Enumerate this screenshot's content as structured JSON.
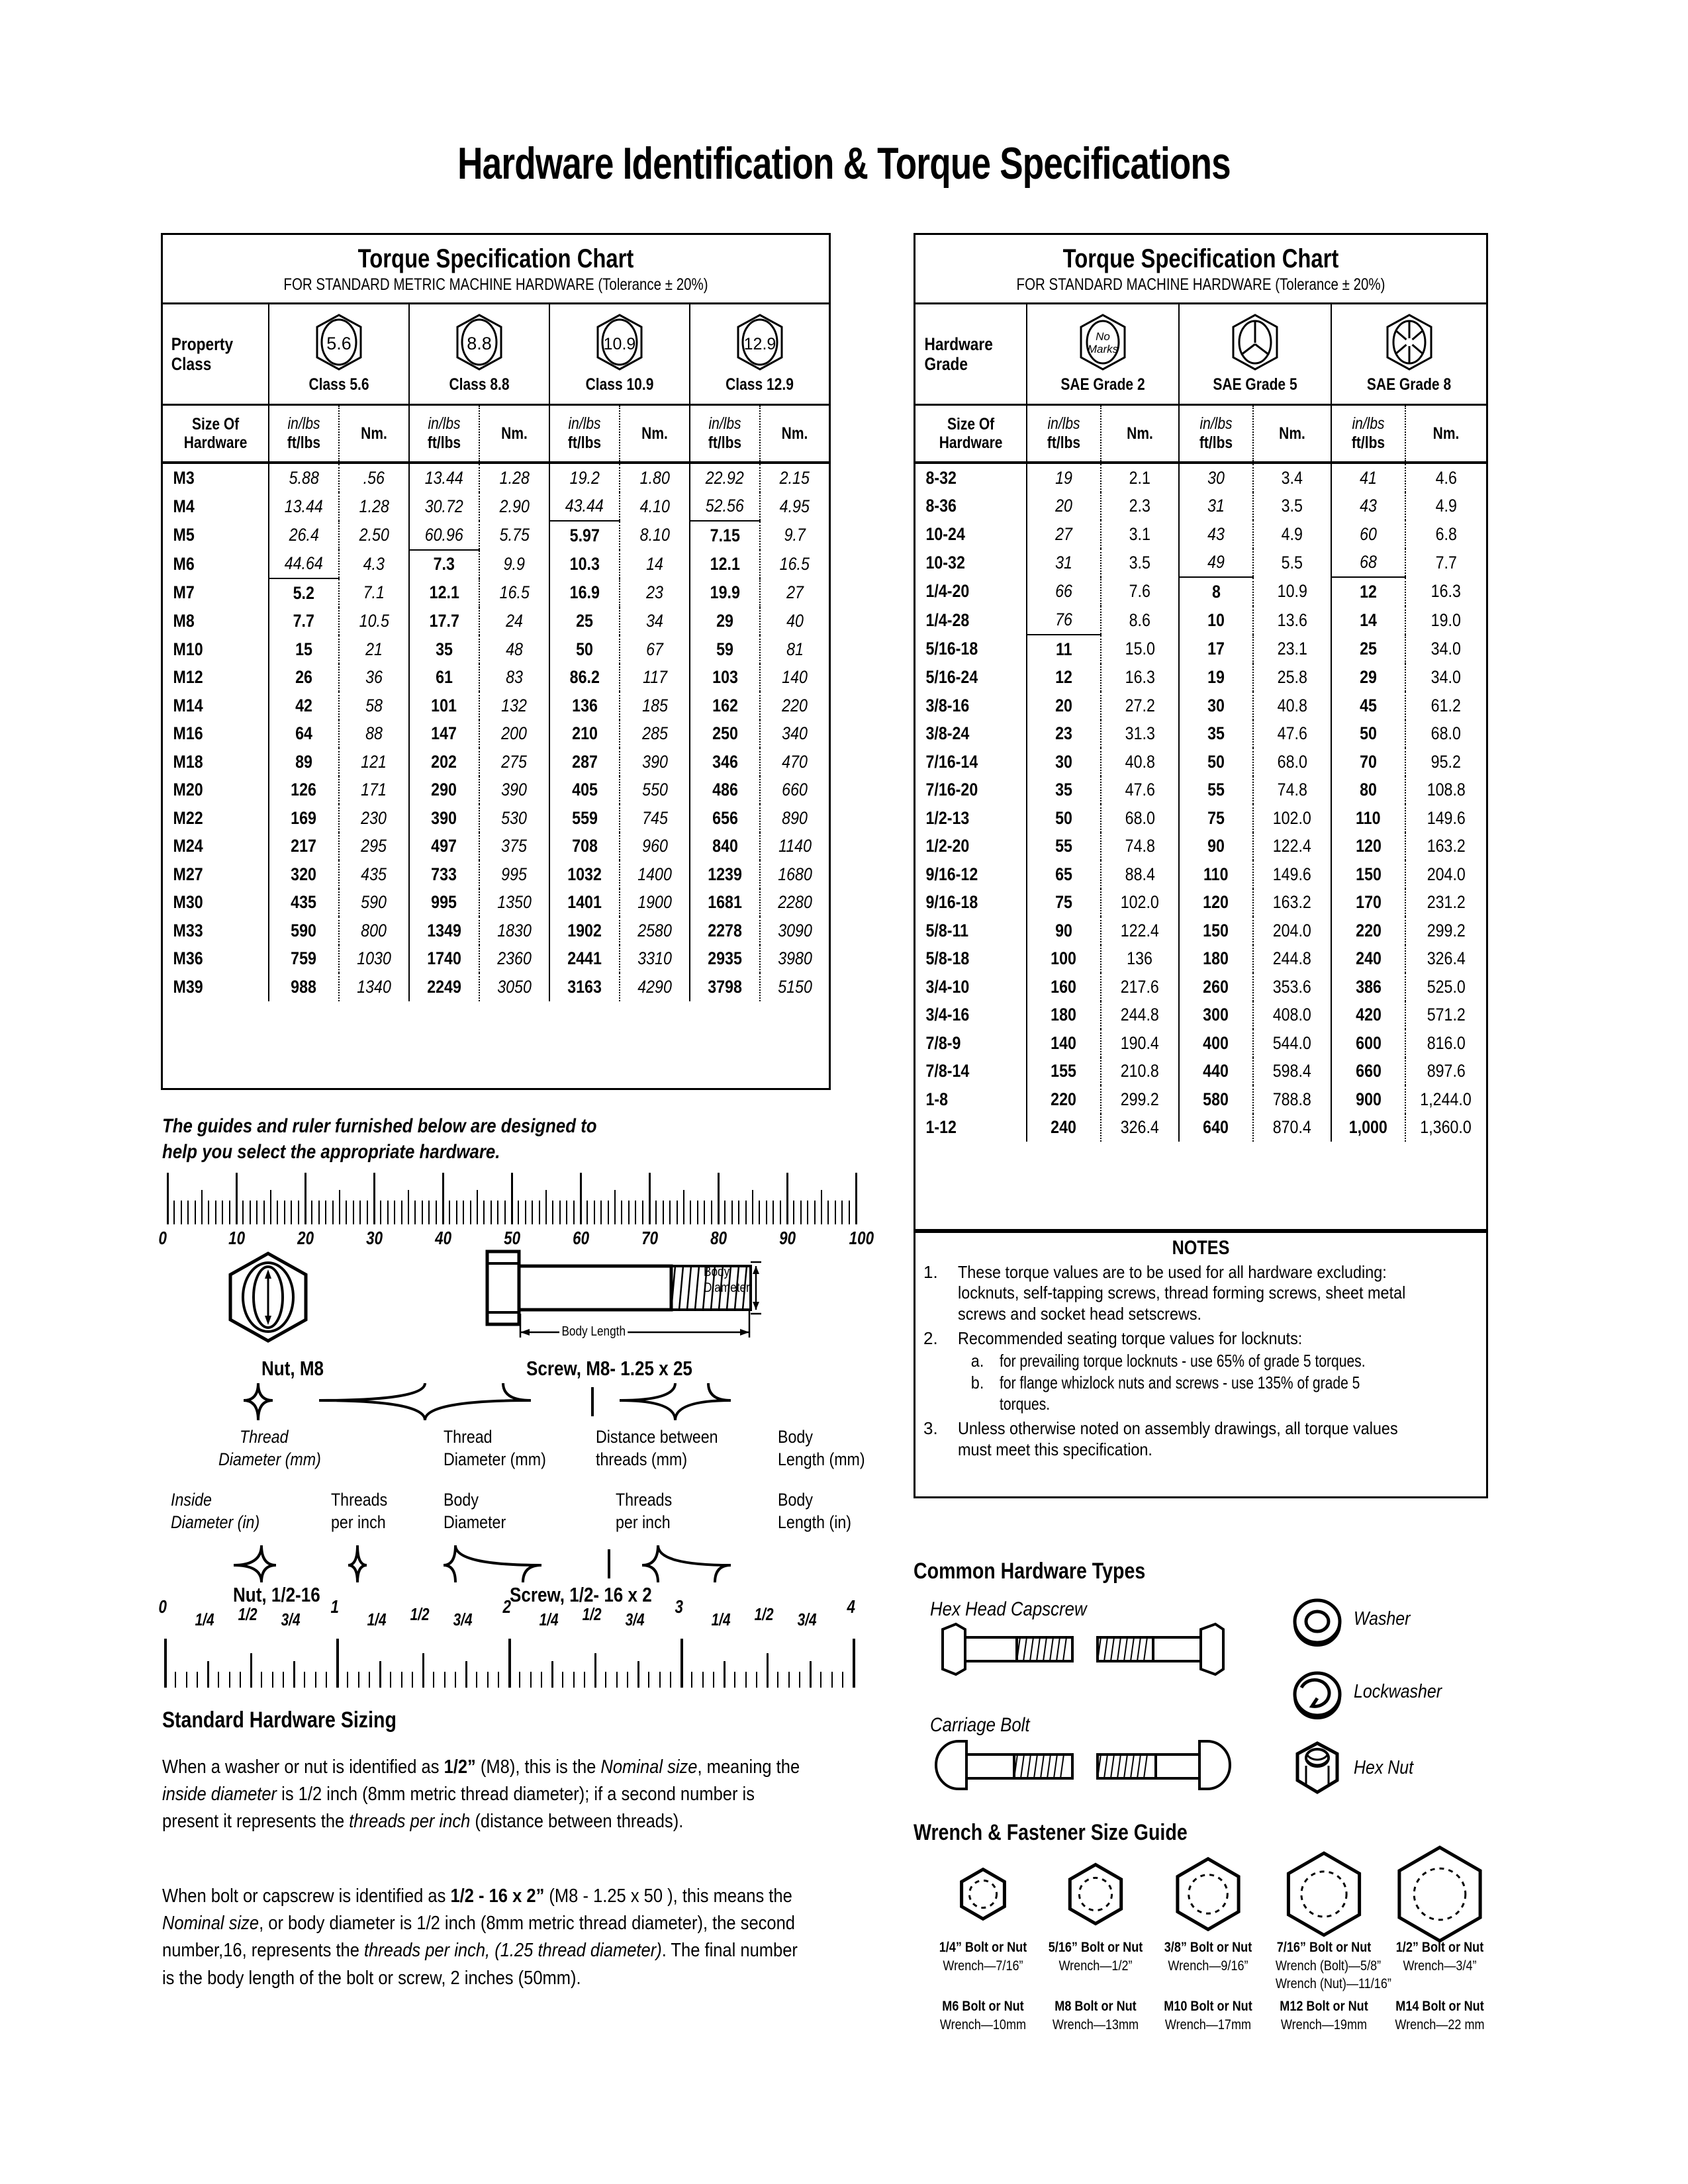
{
  "title": "Hardware Identification  &  Torque Specifications",
  "metric_chart": {
    "title": "Torque Specification Chart",
    "subtitle": "FOR STANDARD METRIC MACHINE HARDWARE (Tolerance ± 20%)",
    "grade_header": "Property Class",
    "size_header": "Size Of Hardware",
    "unit_inlbs": "in/lbs",
    "unit_ftlbs": "ft/lbs",
    "unit_nm": "Nm.",
    "grades": [
      {
        "mark": "5.6",
        "name": "Class 5.6"
      },
      {
        "mark": "8.8",
        "name": "Class 8.8"
      },
      {
        "mark": "10.9",
        "name": "Class 10.9"
      },
      {
        "mark": "12.9",
        "name": "Class 12.9"
      }
    ],
    "rows": [
      {
        "size": "M3",
        "c": [
          "5.88",
          ".56",
          "13.44",
          "1.28",
          "19.2",
          "1.80",
          "22.92",
          "2.15"
        ]
      },
      {
        "size": "M4",
        "c": [
          "13.44",
          "1.28",
          "30.72",
          "2.90",
          "43.44",
          "4.10",
          "52.56",
          "4.95"
        ]
      },
      {
        "size": "M5",
        "c": [
          "26.4",
          "2.50",
          "60.96",
          "5.75",
          "5.97",
          "8.10",
          "7.15",
          "9.7"
        ]
      },
      {
        "size": "M6",
        "c": [
          "44.64",
          "4.3",
          "7.3",
          "9.9",
          "10.3",
          "14",
          "12.1",
          "16.5"
        ]
      },
      {
        "size": "M7",
        "c": [
          "5.2",
          "7.1",
          "12.1",
          "16.5",
          "16.9",
          "23",
          "19.9",
          "27"
        ]
      },
      {
        "size": "M8",
        "c": [
          "7.7",
          "10.5",
          "17.7",
          "24",
          "25",
          "34",
          "29",
          "40"
        ]
      },
      {
        "size": "M10",
        "c": [
          "15",
          "21",
          "35",
          "48",
          "50",
          "67",
          "59",
          "81"
        ]
      },
      {
        "size": "M12",
        "c": [
          "26",
          "36",
          "61",
          "83",
          "86.2",
          "117",
          "103",
          "140"
        ]
      },
      {
        "size": "M14",
        "c": [
          "42",
          "58",
          "101",
          "132",
          "136",
          "185",
          "162",
          "220"
        ]
      },
      {
        "size": "M16",
        "c": [
          "64",
          "88",
          "147",
          "200",
          "210",
          "285",
          "250",
          "340"
        ]
      },
      {
        "size": "M18",
        "c": [
          "89",
          "121",
          "202",
          "275",
          "287",
          "390",
          "346",
          "470"
        ]
      },
      {
        "size": "M20",
        "c": [
          "126",
          "171",
          "290",
          "390",
          "405",
          "550",
          "486",
          "660"
        ]
      },
      {
        "size": "M22",
        "c": [
          "169",
          "230",
          "390",
          "530",
          "559",
          "745",
          "656",
          "890"
        ]
      },
      {
        "size": "M24",
        "c": [
          "217",
          "295",
          "497",
          "375",
          "708",
          "960",
          "840",
          "1140"
        ]
      },
      {
        "size": "M27",
        "c": [
          "320",
          "435",
          "733",
          "995",
          "1032",
          "1400",
          "1239",
          "1680"
        ]
      },
      {
        "size": "M30",
        "c": [
          "435",
          "590",
          "995",
          "1350",
          "1401",
          "1900",
          "1681",
          "2280"
        ]
      },
      {
        "size": "M33",
        "c": [
          "590",
          "800",
          "1349",
          "1830",
          "1902",
          "2580",
          "2278",
          "3090"
        ]
      },
      {
        "size": "M36",
        "c": [
          "759",
          "1030",
          "1740",
          "2360",
          "2441",
          "3310",
          "2935",
          "3980"
        ]
      },
      {
        "size": "M39",
        "c": [
          "988",
          "1340",
          "2249",
          "3050",
          "3163",
          "4290",
          "3798",
          "5150"
        ]
      }
    ]
  },
  "sae_chart": {
    "title": "Torque Specification Chart",
    "subtitle": "FOR STANDARD MACHINE HARDWARE (Tolerance ± 20%)",
    "grade_header": "Hardware Grade",
    "size_header": "Size Of Hardware",
    "unit_inlbs": "in/lbs",
    "unit_ftlbs": "ft/lbs",
    "unit_nm": "Nm.",
    "grades": [
      {
        "mark": "No Marks",
        "name": "SAE Grade 2"
      },
      {
        "mark": "",
        "name": "SAE Grade 5"
      },
      {
        "mark": "",
        "name": "SAE Grade 8"
      }
    ],
    "rows": [
      {
        "size": "8-32",
        "c": [
          "19",
          "2.1",
          "30",
          "3.4",
          "41",
          "4.6"
        ]
      },
      {
        "size": "8-36",
        "c": [
          "20",
          "2.3",
          "31",
          "3.5",
          "43",
          "4.9"
        ]
      },
      {
        "size": "10-24",
        "c": [
          "27",
          "3.1",
          "43",
          "4.9",
          "60",
          "6.8"
        ]
      },
      {
        "size": "10-32",
        "c": [
          "31",
          "3.5",
          "49",
          "5.5",
          "68",
          "7.7"
        ]
      },
      {
        "size": "1/4-20",
        "c": [
          "66",
          "7.6",
          "8",
          "10.9",
          "12",
          "16.3"
        ]
      },
      {
        "size": "1/4-28",
        "c": [
          "76",
          "8.6",
          "10",
          "13.6",
          "14",
          "19.0"
        ]
      },
      {
        "size": "5/16-18",
        "c": [
          "11",
          "15.0",
          "17",
          "23.1",
          "25",
          "34.0"
        ]
      },
      {
        "size": "5/16-24",
        "c": [
          "12",
          "16.3",
          "19",
          "25.8",
          "29",
          "34.0"
        ]
      },
      {
        "size": "3/8-16",
        "c": [
          "20",
          "27.2",
          "30",
          "40.8",
          "45",
          "61.2"
        ]
      },
      {
        "size": "3/8-24",
        "c": [
          "23",
          "31.3",
          "35",
          "47.6",
          "50",
          "68.0"
        ]
      },
      {
        "size": "7/16-14",
        "c": [
          "30",
          "40.8",
          "50",
          "68.0",
          "70",
          "95.2"
        ]
      },
      {
        "size": "7/16-20",
        "c": [
          "35",
          "47.6",
          "55",
          "74.8",
          "80",
          "108.8"
        ]
      },
      {
        "size": "1/2-13",
        "c": [
          "50",
          "68.0",
          "75",
          "102.0",
          "110",
          "149.6"
        ]
      },
      {
        "size": "1/2-20",
        "c": [
          "55",
          "74.8",
          "90",
          "122.4",
          "120",
          "163.2"
        ]
      },
      {
        "size": "9/16-12",
        "c": [
          "65",
          "88.4",
          "110",
          "149.6",
          "150",
          "204.0"
        ]
      },
      {
        "size": "9/16-18",
        "c": [
          "75",
          "102.0",
          "120",
          "163.2",
          "170",
          "231.2"
        ]
      },
      {
        "size": "5/8-11",
        "c": [
          "90",
          "122.4",
          "150",
          "204.0",
          "220",
          "299.2"
        ]
      },
      {
        "size": "5/8-18",
        "c": [
          "100",
          "136",
          "180",
          "244.8",
          "240",
          "326.4"
        ]
      },
      {
        "size": "3/4-10",
        "c": [
          "160",
          "217.6",
          "260",
          "353.6",
          "386",
          "525.0"
        ]
      },
      {
        "size": "3/4-16",
        "c": [
          "180",
          "244.8",
          "300",
          "408.0",
          "420",
          "571.2"
        ]
      },
      {
        "size": "7/8-9",
        "c": [
          "140",
          "190.4",
          "400",
          "544.0",
          "600",
          "816.0"
        ]
      },
      {
        "size": "7/8-14",
        "c": [
          "155",
          "210.8",
          "440",
          "598.4",
          "660",
          "897.6"
        ]
      },
      {
        "size": "1-8",
        "c": [
          "220",
          "299.2",
          "580",
          "788.8",
          "900",
          "1,244.0"
        ]
      },
      {
        "size": "1-12",
        "c": [
          "240",
          "326.4",
          "640",
          "870.4",
          "1,000",
          "1,360.0"
        ]
      }
    ]
  },
  "notes": {
    "heading": "NOTES",
    "items": [
      {
        "num": "1.",
        "text": "These torque values are to be used for all hardware excluding: locknuts, self-tapping screws, thread forming screws, sheet metal screws and socket head setscrews.",
        "sub": []
      },
      {
        "num": "2.",
        "text": "Recommended seating torque values for locknuts:",
        "sub": [
          {
            "num": "a.",
            "text": "for prevailing torque locknuts - use 65% of grade 5 torques."
          },
          {
            "num": "b.",
            "text": "for flange whizlock nuts and screws - use 135% of grade 5 torques."
          }
        ]
      },
      {
        "num": "3.",
        "text": "Unless otherwise noted on assembly drawings, all torque values must meet this specification.",
        "sub": []
      }
    ]
  },
  "guides": {
    "blurb_line1": "The guides and ruler furnished below are designed to",
    "blurb_line2": "help you select the appropriate hardware.",
    "mm_ruler_labels": [
      "0",
      "10",
      "20",
      "30",
      "40",
      "50",
      "60",
      "70",
      "80",
      "90",
      "100"
    ],
    "in_ruler_major": [
      "0",
      "1",
      "2",
      "3",
      "4"
    ],
    "in_ruler_minor": [
      "1/4",
      "1/2",
      "3/4"
    ],
    "nut_metric_caption": "Nut, M8",
    "screw_metric_caption": "Screw, M8- 1.25 x 25",
    "nut_inch_caption": "Nut, 1/2-16",
    "screw_inch_caption": "Screw, 1/2- 16 x 2",
    "body_diameter_label": "Body\nDiameter",
    "body_length_label": "Body Length",
    "metric_callouts": {
      "nut_thread": "Thread\nDiameter (mm)",
      "screw_thread": "Thread\nDiameter (mm)",
      "screw_pitch": "Distance between\nthreads (mm)",
      "screw_length": "Body\nLength (mm)"
    },
    "inch_callouts": {
      "nut_id": "Inside\nDiameter (in)",
      "nut_tpi": "Threads\nper inch",
      "screw_body": "Body\nDiameter",
      "screw_tpi": "Threads\nper inch",
      "screw_length": "Body\nLength (in)"
    }
  },
  "sizing": {
    "heading": "Standard Hardware Sizing",
    "p1": "When a washer or nut is identified as 1/2” (M8), this is the Nominal size, meaning the inside diameter is 1/2 inch (8mm metric thread diameter); if a second number is present it represents the threads per inch (distance between threads).",
    "p2": "When bolt or capscrew is identified as 1/2 - 16 x 2” (M8 - 1.25 x 50 ), this means the Nominal size, or body diameter is 1/2 inch (8mm metric thread diameter), the second number,16, represents the threads per inch, (1.25 thread diameter). The final number is the body length of the bolt or screw, 2 inches (50mm)."
  },
  "hardware_types": {
    "heading": "Common Hardware Types",
    "items": [
      {
        "name": "Hex Head Capscrew"
      },
      {
        "name": "Carriage Bolt"
      },
      {
        "name": "Washer"
      },
      {
        "name": "Lockwasher"
      },
      {
        "name": "Hex Nut"
      }
    ]
  },
  "wrench_guide": {
    "heading": "Wrench & Fastener Size Guide",
    "items": [
      {
        "imperial": "1/4” Bolt or Nut",
        "imperial_wrench": "Wrench—7/16”",
        "imperial_wrench2": "",
        "metric": "M6 Bolt or Nut",
        "metric_wrench": "Wrench—10mm",
        "size": 52
      },
      {
        "imperial": "5/16” Bolt or Nut",
        "imperial_wrench": "Wrench—1/2”",
        "imperial_wrench2": "",
        "metric": "M8 Bolt or Nut",
        "metric_wrench": "Wrench—13mm",
        "size": 62
      },
      {
        "imperial": "3/8” Bolt or Nut",
        "imperial_wrench": "Wrench—9/16”",
        "imperial_wrench2": "",
        "metric": "M10 Bolt or Nut",
        "metric_wrench": "Wrench—17mm",
        "size": 74
      },
      {
        "imperial": "7/16” Bolt or Nut",
        "imperial_wrench": "Wrench (Bolt)—5/8”",
        "imperial_wrench2": "Wrench (Nut)—11/16”",
        "metric": "M12 Bolt or Nut",
        "metric_wrench": "Wrench—19mm",
        "size": 86
      },
      {
        "imperial": "1/2” Bolt or Nut",
        "imperial_wrench": "Wrench—3/4”",
        "imperial_wrench2": "",
        "metric": "M14 Bolt or Nut",
        "metric_wrench": "Wrench—22 mm",
        "size": 98
      }
    ]
  }
}
